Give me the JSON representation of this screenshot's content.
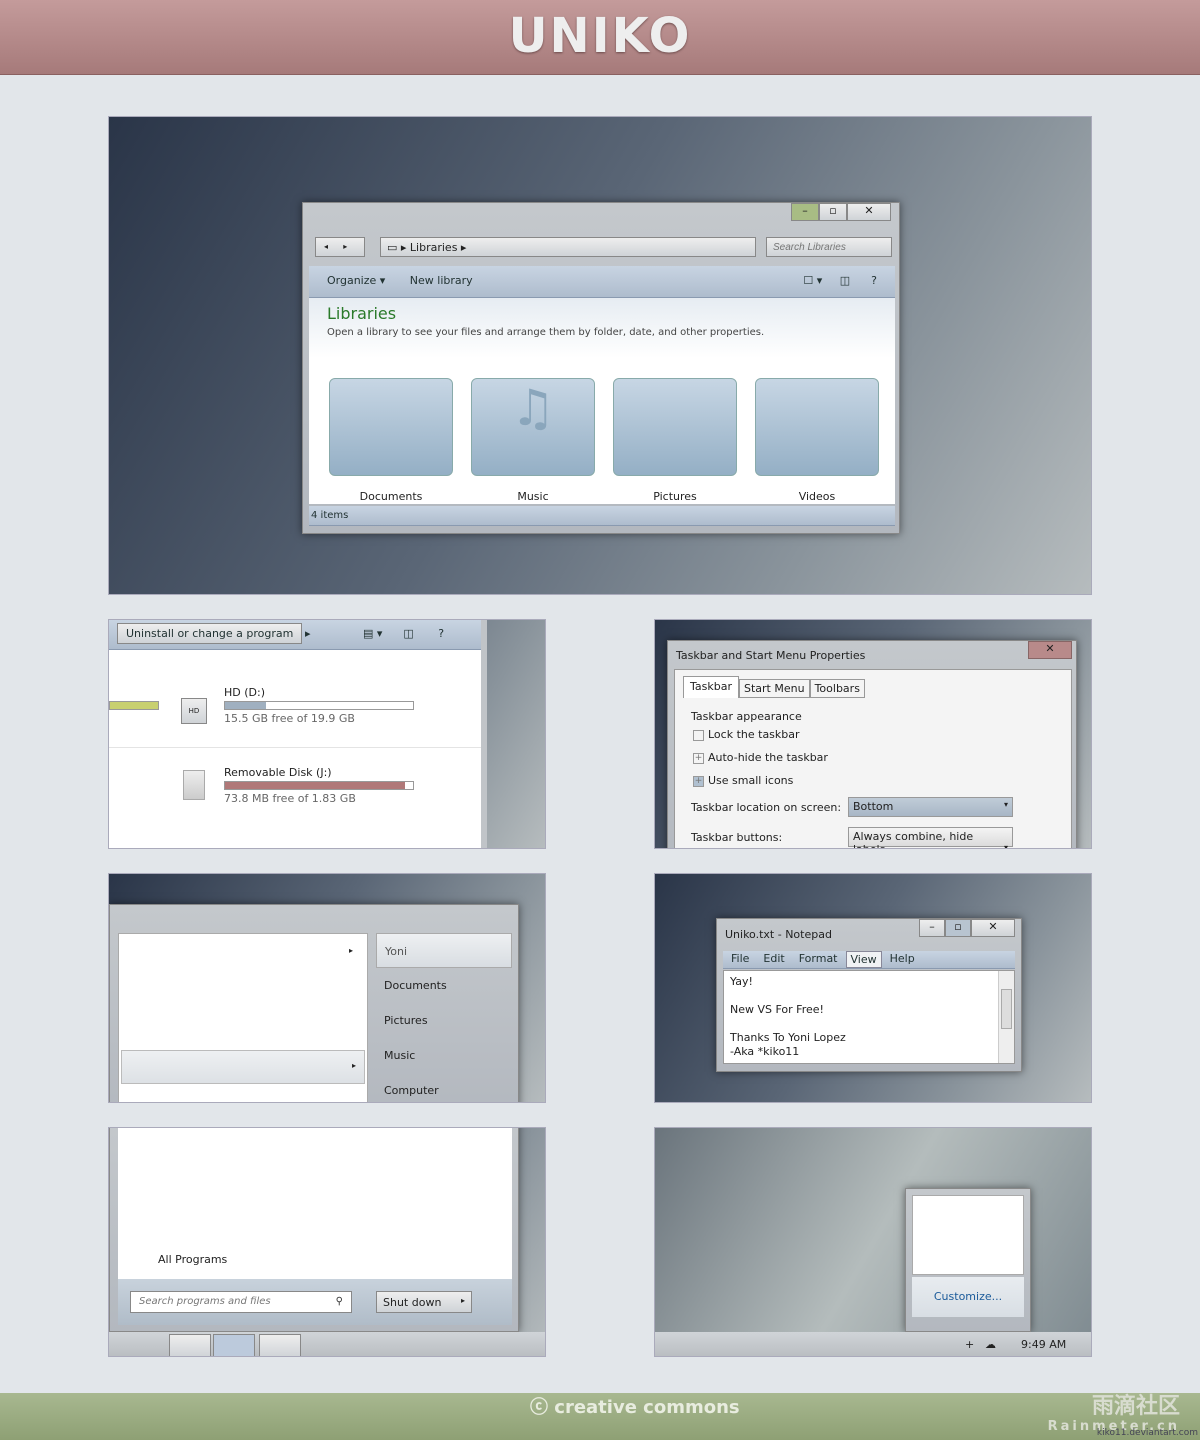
{
  "header": {
    "logo": "UNIKO"
  },
  "explorer": {
    "address": "Libraries",
    "search_placeholder": "Search Libraries",
    "organize": "Organize",
    "new_library": "New library",
    "title": "Libraries",
    "subtitle": "Open a library to see your files and arrange them by folder, date, and other properties.",
    "libraries": [
      {
        "label": "Documents",
        "icon": "document-icon"
      },
      {
        "label": "Music",
        "icon": "music-note-icon"
      },
      {
        "label": "Pictures",
        "icon": "picture-icon"
      },
      {
        "label": "Videos",
        "icon": "video-camera-icon"
      }
    ],
    "status": "4 items"
  },
  "programs": {
    "toolbar_button": "Uninstall or change a program",
    "drives": [
      {
        "name": "HD (D:)",
        "free": "15.5 GB free of 19.9 GB",
        "fill": 22,
        "color": "#a0b0c0"
      },
      {
        "name": "Removable Disk (J:)",
        "free": "73.8 MB free of 1.83 GB",
        "fill": 96,
        "color": "#b07878"
      }
    ],
    "left_fill_color": "#c8d070"
  },
  "taskbar_props": {
    "title": "Taskbar and Start Menu Properties",
    "tabs": [
      "Taskbar",
      "Start Menu",
      "Toolbars"
    ],
    "group": "Taskbar appearance",
    "options": [
      {
        "label": "Lock the taskbar",
        "checked": false
      },
      {
        "label": "Auto-hide the taskbar",
        "checked": false
      },
      {
        "label": "Use small icons",
        "checked": true
      }
    ],
    "location_label": "Taskbar location on screen:",
    "location_value": "Bottom",
    "buttons_label": "Taskbar buttons:",
    "buttons_value": "Always combine, hide labels"
  },
  "start_menu": {
    "items": [
      "Yoni",
      "Documents",
      "Pictures",
      "Music",
      "Computer"
    ],
    "all_programs": "All Programs",
    "search_placeholder": "Search programs and files",
    "shutdown": "Shut down"
  },
  "notepad": {
    "title": "Uniko.txt - Notepad",
    "menu": [
      "File",
      "Edit",
      "Format",
      "View",
      "Help"
    ],
    "lines": [
      "Yay!",
      "",
      "New VS For Free!",
      "",
      "Thanks To Yoni Lopez",
      "-Aka *kiko11"
    ]
  },
  "tray": {
    "customize": "Customize...",
    "time": "9:49 AM"
  },
  "footer": {
    "cc": "creative commons",
    "site_cn": "雨滴社区",
    "site": "Rainmeter.cn",
    "credit": "kiko11.deviantart.com"
  }
}
